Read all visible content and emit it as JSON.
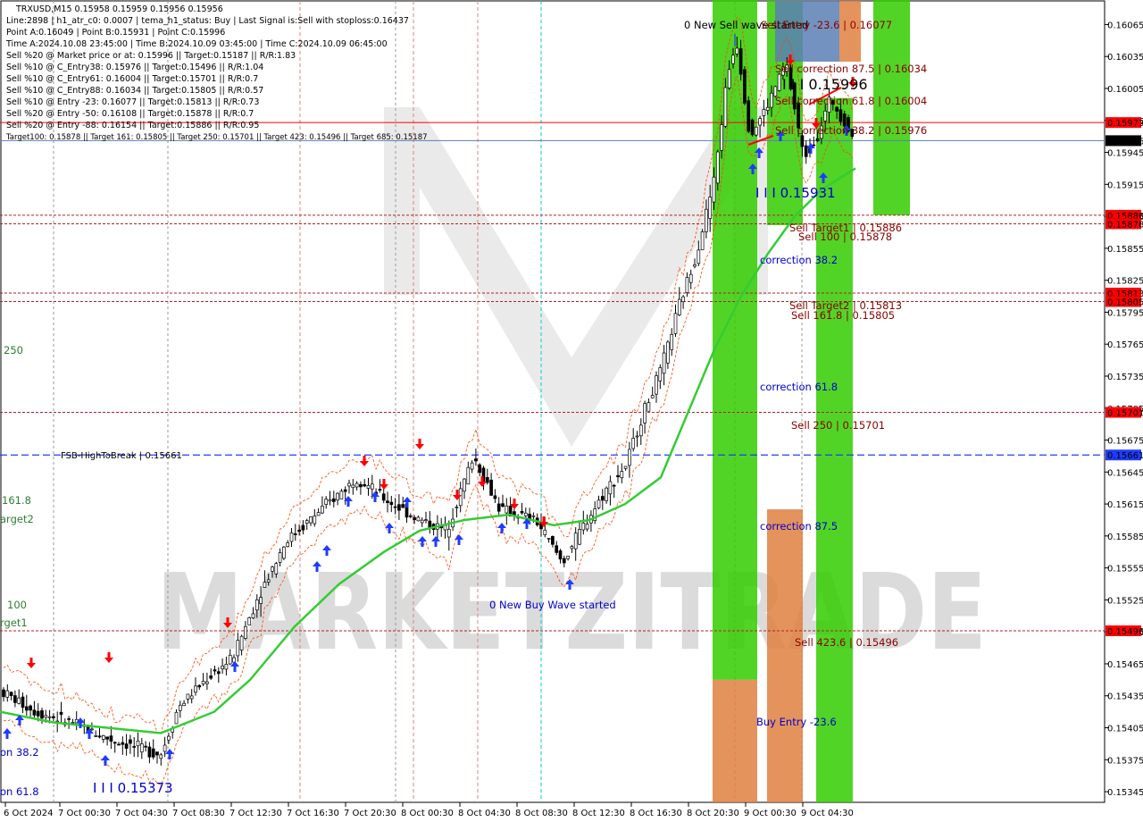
{
  "info_lines": [
    "TRXUSD,M15  0.15958 0.15959 0.15956 0.15956",
    "Line:2898 | h1_atr_c0: 0.0007 | tema_h1_status: Buy | Last Signal is:Sell with stoploss:0.16437",
    "Point A:0.16049 | Point B:0.15931 | Point C:0.15996",
    "Time A:2024.10.08 23:45:00 | Time B:2024.10.09 03:45:00 | Time C:2024.10.09 06:45:00",
    "Sell %20 @ Market price or at: 0.15996 || Target:0.15187 || R/R:1.83",
    "Sell %10 @ C_Entry38: 0.15976 || Target:0.15496 || R/R:1.04",
    "Sell %10 @ C_Entry61: 0.16004 || Target:0.15701 || R/R:0.7",
    "Sell %10 @ C_Entry88: 0.16034 || Target:0.15805 || R/R:0.57",
    "Sell %10 @ Entry -23: 0.16077 || Target:0.15813 || R/R:0.73",
    "Sell %20 @ Entry -50: 0.16108 || Target:0.15878 || R/R:0.7",
    "Sell %20 @ Entry -88: 0.16154 || Target:0.15886 || R/R:0.95",
    "Target100: 0.15878 || Target 161: 0.15805 || Target 250: 0.15701 || Target 423: 0.15496 || Target 685: 0.15187"
  ],
  "price_axis": {
    "labels": [
      "0.16065",
      "0.16035",
      "0.16005",
      "0.15975",
      "0.15945",
      "0.15915",
      "0.15885",
      "0.15855",
      "0.15825",
      "0.15795",
      "0.15765",
      "0.15735",
      "0.15705",
      "0.15675",
      "0.15645",
      "0.15615",
      "0.15585",
      "0.15555",
      "0.15525",
      "0.15495",
      "0.15465",
      "0.15435",
      "0.15405",
      "0.15375",
      "0.15345"
    ]
  },
  "time_axis": {
    "labels": [
      "6 Oct 2024",
      "7 Oct 00:30",
      "7 Oct 04:30",
      "7 Oct 08:30",
      "7 Oct 12:30",
      "7 Oct 16:30",
      "7 Oct 20:30",
      "8 Oct 00:30",
      "8 Oct 04:30",
      "8 Oct 08:30",
      "8 Oct 12:30",
      "8 Oct 16:30",
      "8 Oct 20:30",
      "9 Oct 00:30",
      "9 Oct 04:30"
    ]
  },
  "price_tags": [
    {
      "text": "0.15973",
      "price": 0.15973,
      "bg": "#ff0000",
      "fg": "#ffffff"
    },
    {
      "text": "0.15956",
      "price": 0.15956,
      "bg": "#000000",
      "fg": "#ffffff"
    },
    {
      "text": "0.15886",
      "price": 0.15886,
      "bg": "#ff0000",
      "fg": "#ffffff"
    },
    {
      "text": "0.15878",
      "price": 0.15878,
      "bg": "#ff0000",
      "fg": "#ffffff"
    },
    {
      "text": "0.15813",
      "price": 0.15813,
      "bg": "#ff0000",
      "fg": "#ffffff"
    },
    {
      "text": "0.15805",
      "price": 0.15805,
      "bg": "#ff0000",
      "fg": "#ffffff"
    },
    {
      "text": "0.15701",
      "price": 0.15701,
      "bg": "#ff0000",
      "fg": "#ffffff"
    },
    {
      "text": "0.15661",
      "price": 0.15661,
      "bg": "#1e3cff",
      "fg": "#ffffff"
    },
    {
      "text": "0.15496",
      "price": 0.15496,
      "bg": "#ff0000",
      "fg": "#ffffff"
    }
  ],
  "level_labels": [
    {
      "text": "0 New Sell wave started",
      "color": "#000000"
    },
    {
      "text": "Sell Entry -23.6 | 0.16077",
      "color": "#8b0000"
    },
    {
      "text": "Sell correction 87.5 | 0.16034",
      "color": "#8b0000"
    },
    {
      "text": "I I I 0.15996",
      "color": "#000000"
    },
    {
      "text": "Sell correction 61.8 | 0.16004",
      "color": "#8b0000"
    },
    {
      "text": "Sell correction 38.2 | 0.15976",
      "color": "#8b0000"
    },
    {
      "text": "I I I 0.15931",
      "color": "#0000cd"
    },
    {
      "text": "Sell Target1 | 0.15886",
      "color": "#8b0000"
    },
    {
      "text": "Sell 100 | 0.15878",
      "color": "#8b0000"
    },
    {
      "text": "correction 38.2",
      "color": "#0000cd"
    },
    {
      "text": "Sell Target2 | 0.15813",
      "color": "#8b0000"
    },
    {
      "text": "Sell 161.8 | 0.15805",
      "color": "#8b0000"
    },
    {
      "text": "correction 61.8",
      "color": "#0000cd"
    },
    {
      "text": "Sell  250 | 0.15701",
      "color": "#8b0000"
    },
    {
      "text": "FSB-HighToBreak  |  0.15661",
      "color": "#000000"
    },
    {
      "text": "correction 87.5",
      "color": "#0000cd"
    },
    {
      "text": "0 New Buy Wave started",
      "color": "#0000cd"
    },
    {
      "text": "Sell  423.6 | 0.15496",
      "color": "#8b0000"
    },
    {
      "text": "Buy Entry -23.6",
      "color": "#0000cd"
    },
    {
      "text": "I I I 0.15373",
      "color": "#0000cd"
    }
  ],
  "left_edge_labels": [
    "250",
    "161.8",
    "arget2",
    "100",
    "rget1",
    "on 38.2",
    "on 61.8"
  ],
  "watermark": "MARKETZITRADE",
  "chart_data": {
    "type": "candlestick",
    "symbol": "TRXUSD",
    "timeframe": "M15",
    "ylim": [
      0.15335,
      0.16088
    ],
    "key_prices": {
      "market": 0.15956,
      "red_line": 0.15973,
      "point_A": 0.16049,
      "point_B": 0.15931,
      "point_C": 0.15996,
      "fsb_high_to_break": 0.15661,
      "sell_targets": [
        0.15886,
        0.15878,
        0.15813,
        0.15805,
        0.15701,
        0.15496
      ],
      "low_marker": 0.15373
    },
    "price_path": [
      [
        0,
        0.1544
      ],
      [
        40,
        0.1542
      ],
      [
        80,
        0.1541
      ],
      [
        120,
        0.15395
      ],
      [
        160,
        0.15385
      ],
      [
        180,
        0.1538
      ],
      [
        200,
        0.15425
      ],
      [
        230,
        0.1545
      ],
      [
        260,
        0.1547
      ],
      [
        290,
        0.1553
      ],
      [
        320,
        0.1558
      ],
      [
        360,
        0.1561
      ],
      [
        400,
        0.1564
      ],
      [
        430,
        0.1562
      ],
      [
        470,
        0.156
      ],
      [
        500,
        0.1559
      ],
      [
        530,
        0.1566
      ],
      [
        560,
        0.1561
      ],
      [
        600,
        0.156
      ],
      [
        630,
        0.1556
      ],
      [
        650,
        0.1559
      ],
      [
        680,
        0.1563
      ],
      [
        700,
        0.1565
      ],
      [
        720,
        0.157
      ],
      [
        740,
        0.1574
      ],
      [
        760,
        0.158
      ],
      [
        780,
        0.1585
      ],
      [
        800,
        0.1592
      ],
      [
        815,
        0.1602
      ],
      [
        825,
        0.16049
      ],
      [
        840,
        0.1596
      ],
      [
        860,
        0.1599
      ],
      [
        880,
        0.1603
      ],
      [
        900,
        0.1594
      ],
      [
        915,
        0.1596
      ],
      [
        930,
        0.15996
      ],
      [
        945,
        0.15975
      ],
      [
        958,
        0.15956
      ]
    ],
    "ma_path": [
      [
        0,
        0.1542
      ],
      [
        60,
        0.1541
      ],
      [
        120,
        0.15405
      ],
      [
        180,
        0.154
      ],
      [
        240,
        0.1542
      ],
      [
        280,
        0.1545
      ],
      [
        330,
        0.155
      ],
      [
        380,
        0.1554
      ],
      [
        430,
        0.1557
      ],
      [
        470,
        0.1559
      ],
      [
        520,
        0.156
      ],
      [
        570,
        0.15605
      ],
      [
        620,
        0.15595
      ],
      [
        660,
        0.156
      ],
      [
        700,
        0.15615
      ],
      [
        740,
        0.1564
      ],
      [
        770,
        0.157
      ],
      [
        800,
        0.1576
      ],
      [
        830,
        0.1581
      ],
      [
        860,
        0.1585
      ],
      [
        890,
        0.15885
      ],
      [
        920,
        0.1591
      ],
      [
        958,
        0.1593
      ]
    ],
    "zones": [
      {
        "name": "green-zone-1",
        "color": "#33cc00",
        "price_top": 0.16088,
        "price_bottom": 0.1545
      },
      {
        "name": "orange-zone-1",
        "color": "#e08040",
        "price_top": 0.1545,
        "price_bottom": 0.15335
      },
      {
        "name": "orange-zone-2",
        "color": "#e08040",
        "price_top": 0.1561,
        "price_bottom": 0.15335
      },
      {
        "name": "green-zone-3",
        "color": "#33cc00",
        "price_top": 0.15996,
        "price_bottom": 0.15335
      },
      {
        "name": "green-zone-4",
        "color": "#33cc00",
        "price_top": 0.16088,
        "price_bottom": 0.15886
      }
    ]
  }
}
